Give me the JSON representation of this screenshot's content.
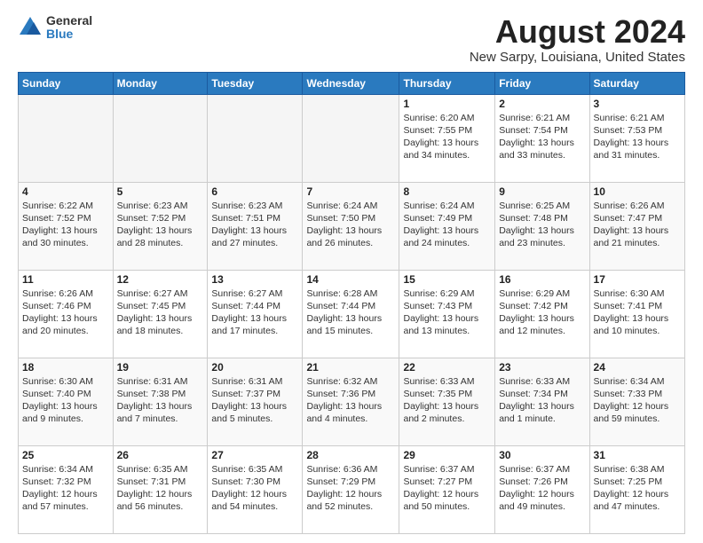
{
  "logo": {
    "general": "General",
    "blue": "Blue"
  },
  "title": "August 2024",
  "subtitle": "New Sarpy, Louisiana, United States",
  "days_of_week": [
    "Sunday",
    "Monday",
    "Tuesday",
    "Wednesday",
    "Thursday",
    "Friday",
    "Saturday"
  ],
  "weeks": [
    [
      {
        "day": "",
        "info": ""
      },
      {
        "day": "",
        "info": ""
      },
      {
        "day": "",
        "info": ""
      },
      {
        "day": "",
        "info": ""
      },
      {
        "day": "1",
        "info": "Sunrise: 6:20 AM\nSunset: 7:55 PM\nDaylight: 13 hours\nand 34 minutes."
      },
      {
        "day": "2",
        "info": "Sunrise: 6:21 AM\nSunset: 7:54 PM\nDaylight: 13 hours\nand 33 minutes."
      },
      {
        "day": "3",
        "info": "Sunrise: 6:21 AM\nSunset: 7:53 PM\nDaylight: 13 hours\nand 31 minutes."
      }
    ],
    [
      {
        "day": "4",
        "info": "Sunrise: 6:22 AM\nSunset: 7:52 PM\nDaylight: 13 hours\nand 30 minutes."
      },
      {
        "day": "5",
        "info": "Sunrise: 6:23 AM\nSunset: 7:52 PM\nDaylight: 13 hours\nand 28 minutes."
      },
      {
        "day": "6",
        "info": "Sunrise: 6:23 AM\nSunset: 7:51 PM\nDaylight: 13 hours\nand 27 minutes."
      },
      {
        "day": "7",
        "info": "Sunrise: 6:24 AM\nSunset: 7:50 PM\nDaylight: 13 hours\nand 26 minutes."
      },
      {
        "day": "8",
        "info": "Sunrise: 6:24 AM\nSunset: 7:49 PM\nDaylight: 13 hours\nand 24 minutes."
      },
      {
        "day": "9",
        "info": "Sunrise: 6:25 AM\nSunset: 7:48 PM\nDaylight: 13 hours\nand 23 minutes."
      },
      {
        "day": "10",
        "info": "Sunrise: 6:26 AM\nSunset: 7:47 PM\nDaylight: 13 hours\nand 21 minutes."
      }
    ],
    [
      {
        "day": "11",
        "info": "Sunrise: 6:26 AM\nSunset: 7:46 PM\nDaylight: 13 hours\nand 20 minutes."
      },
      {
        "day": "12",
        "info": "Sunrise: 6:27 AM\nSunset: 7:45 PM\nDaylight: 13 hours\nand 18 minutes."
      },
      {
        "day": "13",
        "info": "Sunrise: 6:27 AM\nSunset: 7:44 PM\nDaylight: 13 hours\nand 17 minutes."
      },
      {
        "day": "14",
        "info": "Sunrise: 6:28 AM\nSunset: 7:44 PM\nDaylight: 13 hours\nand 15 minutes."
      },
      {
        "day": "15",
        "info": "Sunrise: 6:29 AM\nSunset: 7:43 PM\nDaylight: 13 hours\nand 13 minutes."
      },
      {
        "day": "16",
        "info": "Sunrise: 6:29 AM\nSunset: 7:42 PM\nDaylight: 13 hours\nand 12 minutes."
      },
      {
        "day": "17",
        "info": "Sunrise: 6:30 AM\nSunset: 7:41 PM\nDaylight: 13 hours\nand 10 minutes."
      }
    ],
    [
      {
        "day": "18",
        "info": "Sunrise: 6:30 AM\nSunset: 7:40 PM\nDaylight: 13 hours\nand 9 minutes."
      },
      {
        "day": "19",
        "info": "Sunrise: 6:31 AM\nSunset: 7:38 PM\nDaylight: 13 hours\nand 7 minutes."
      },
      {
        "day": "20",
        "info": "Sunrise: 6:31 AM\nSunset: 7:37 PM\nDaylight: 13 hours\nand 5 minutes."
      },
      {
        "day": "21",
        "info": "Sunrise: 6:32 AM\nSunset: 7:36 PM\nDaylight: 13 hours\nand 4 minutes."
      },
      {
        "day": "22",
        "info": "Sunrise: 6:33 AM\nSunset: 7:35 PM\nDaylight: 13 hours\nand 2 minutes."
      },
      {
        "day": "23",
        "info": "Sunrise: 6:33 AM\nSunset: 7:34 PM\nDaylight: 13 hours\nand 1 minute."
      },
      {
        "day": "24",
        "info": "Sunrise: 6:34 AM\nSunset: 7:33 PM\nDaylight: 12 hours\nand 59 minutes."
      }
    ],
    [
      {
        "day": "25",
        "info": "Sunrise: 6:34 AM\nSunset: 7:32 PM\nDaylight: 12 hours\nand 57 minutes."
      },
      {
        "day": "26",
        "info": "Sunrise: 6:35 AM\nSunset: 7:31 PM\nDaylight: 12 hours\nand 56 minutes."
      },
      {
        "day": "27",
        "info": "Sunrise: 6:35 AM\nSunset: 7:30 PM\nDaylight: 12 hours\nand 54 minutes."
      },
      {
        "day": "28",
        "info": "Sunrise: 6:36 AM\nSunset: 7:29 PM\nDaylight: 12 hours\nand 52 minutes."
      },
      {
        "day": "29",
        "info": "Sunrise: 6:37 AM\nSunset: 7:27 PM\nDaylight: 12 hours\nand 50 minutes."
      },
      {
        "day": "30",
        "info": "Sunrise: 6:37 AM\nSunset: 7:26 PM\nDaylight: 12 hours\nand 49 minutes."
      },
      {
        "day": "31",
        "info": "Sunrise: 6:38 AM\nSunset: 7:25 PM\nDaylight: 12 hours\nand 47 minutes."
      }
    ]
  ]
}
